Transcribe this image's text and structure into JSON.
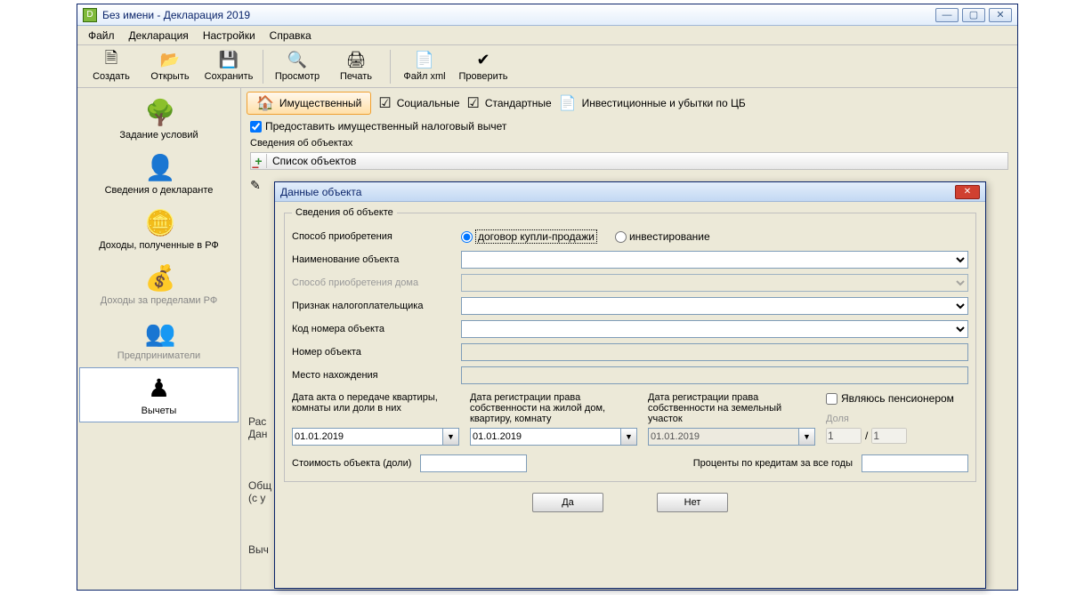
{
  "window": {
    "title": "Без имени - Декларация 2019"
  },
  "menu": {
    "file": "Файл",
    "decl": "Декларация",
    "settings": "Настройки",
    "help": "Справка"
  },
  "toolbar": {
    "create": "Создать",
    "open": "Открыть",
    "save": "Сохранить",
    "preview": "Просмотр",
    "print": "Печать",
    "xml": "Файл xml",
    "check": "Проверить"
  },
  "sidebar": {
    "conditions": "Задание условий",
    "declarant": "Сведения о декларанте",
    "income_rf": "Доходы, полученные в РФ",
    "income_abroad": "Доходы за пределами РФ",
    "entrepreneur": "Предприниматели",
    "deductions": "Вычеты"
  },
  "tabs": {
    "property": "Имущественный",
    "social": "Социальные",
    "standard": "Стандартные",
    "investment": "Инвестиционные и убытки по ЦБ"
  },
  "main": {
    "provide_checkbox": "Предоставить имущественный налоговый вычет",
    "objects_section": "Сведения об объектах",
    "list_header": "Список объектов",
    "calc": "Рас",
    "data": "Дан",
    "total": "Общ",
    "paren": "(с у",
    "ded": "Выч"
  },
  "dialog": {
    "title": "Данные объекта",
    "fieldset": "Сведения об объекте",
    "acq_method": "Способ приобретения",
    "radio_purchase": "договор купли-продажи",
    "radio_invest": "инвестирование",
    "object_name": "Наименование объекта",
    "house_method": "Способ приобретения дома",
    "taxpayer_sign": "Признак налогоплательщика",
    "number_code": "Код номера объекта",
    "object_number": "Номер объекта",
    "location": "Место нахождения",
    "date1_label": "Дата акта о передаче квартиры, комнаты или доли в них",
    "date2_label": "Дата регистрации права собственности на жилой дом, квартиру, комнату",
    "date3_label": "Дата регистрации права собственности на земельный участок",
    "pensioner": "Являюсь пенсионером",
    "share": "Доля",
    "date1": "01.01.2019",
    "date2": "01.01.2019",
    "date3": "01.01.2019",
    "share1": "1",
    "share2": "1",
    "cost_label": "Стоимость объекта (доли)",
    "interest_label": "Проценты по кредитам за все годы",
    "ok": "Да",
    "cancel": "Нет"
  }
}
